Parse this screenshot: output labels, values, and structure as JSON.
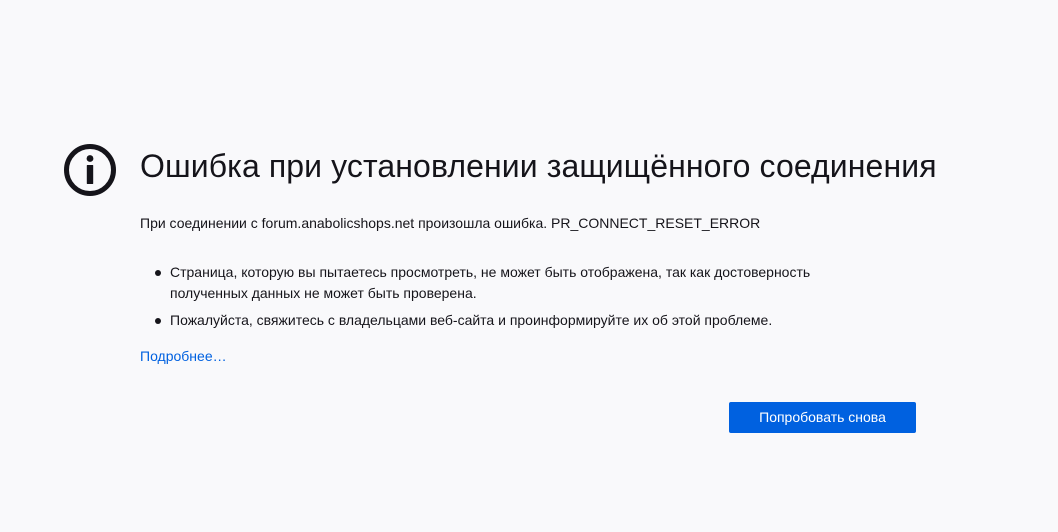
{
  "error": {
    "icon": "info-icon",
    "title": "Ошибка при установлении защищённого соединения",
    "description": "При соединении с forum.anabolicshops.net произошла ошибка. PR_CONNECT_RESET_ERROR",
    "bullets": [
      "Страница, которую вы пытаетесь просмотреть, не может быть отображена, так как достоверность полученных данных не может быть проверена.",
      "Пожалуйста, свяжитесь с владельцами веб-сайта и проинформируйте их об этой проблеме."
    ],
    "more_link": "Подробнее…",
    "retry_button": "Попробовать снова"
  },
  "colors": {
    "background": "#f9f9fb",
    "text": "#15141a",
    "accent": "#0061e0"
  }
}
